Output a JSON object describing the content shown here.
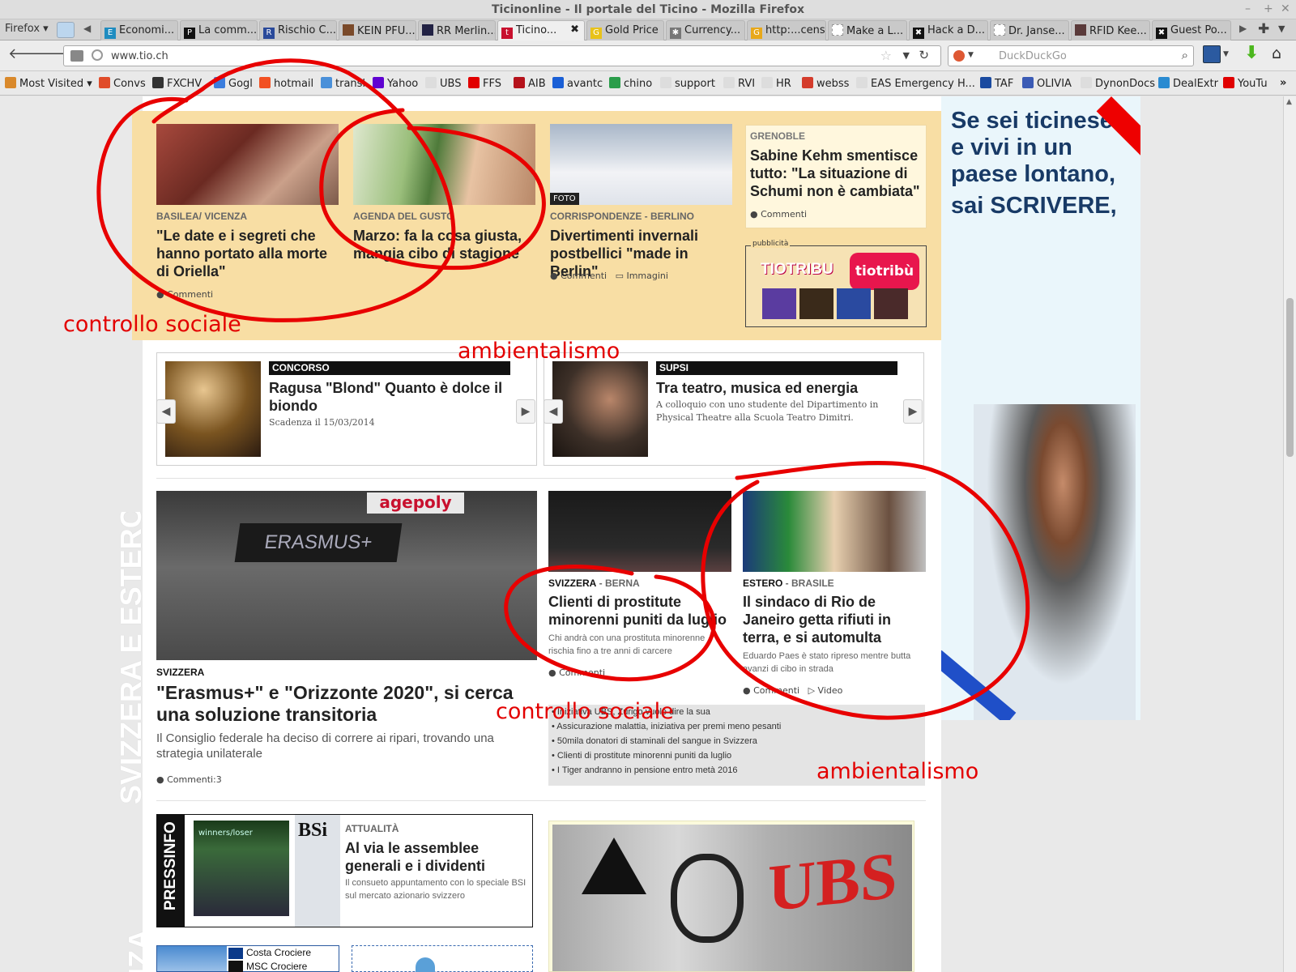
{
  "window": {
    "title": "Ticinonline - Il portale del Ticino - Mozilla Firefox",
    "controls": [
      "–",
      "+",
      "✕"
    ]
  },
  "tabs": {
    "menu": "Firefox ▾",
    "items": [
      {
        "label": "Economi...",
        "icon": "EFJ"
      },
      {
        "label": "La comm...",
        "icon": "Ph"
      },
      {
        "label": "Rischio C...",
        "icon": "Rc"
      },
      {
        "label": "KEIN PFU...",
        "icon": ""
      },
      {
        "label": "RR Merlin...",
        "icon": ""
      },
      {
        "label": "Ticino...",
        "icon": "tio"
      },
      {
        "label": "Gold Price",
        "icon": "G"
      },
      {
        "label": "Currency...",
        "icon": ""
      },
      {
        "label": "http:...cens",
        "icon": "G"
      },
      {
        "label": "Make a L...",
        "icon": ""
      },
      {
        "label": "Hack a D...",
        "icon": ""
      },
      {
        "label": "Dr. Janse...",
        "icon": ""
      },
      {
        "label": "RFID Kee...",
        "icon": ""
      },
      {
        "label": "Guest Po...",
        "icon": ""
      }
    ],
    "close": "✖"
  },
  "navbar": {
    "url": "www.tio.ch",
    "search_placeholder": "DuckDuckGo"
  },
  "bookmarks": [
    {
      "label": "Most Visited ▾",
      "color": "#d9892b"
    },
    {
      "label": "Convs",
      "color": "#e04c2a"
    },
    {
      "label": "FXCHV",
      "color": "#333333"
    },
    {
      "label": "Gogl",
      "color": "#3b7ddd"
    },
    {
      "label": "hotmail",
      "color": "#f25022"
    },
    {
      "label": "transl",
      "color": "#4a90d9"
    },
    {
      "label": "Yahoo",
      "color": "#5f01d1"
    },
    {
      "label": "UBS",
      "color": "#dddddd"
    },
    {
      "label": "FFS",
      "color": "#e10000"
    },
    {
      "label": "AIB",
      "color": "#b5121b"
    },
    {
      "label": "avantc",
      "color": "#1a5fd6"
    },
    {
      "label": "chino",
      "color": "#2a9d4a"
    },
    {
      "label": "support",
      "color": "#dddddd"
    },
    {
      "label": "RVI",
      "color": "#dddddd"
    },
    {
      "label": "HR",
      "color": "#dddddd"
    },
    {
      "label": "webss",
      "color": "#d43c2c"
    },
    {
      "label": "EAS Emergency H...",
      "color": "#dddddd"
    },
    {
      "label": "TAF",
      "color": "#1b4ba0"
    },
    {
      "label": "OLIVIA",
      "color": "#3b5bb5"
    },
    {
      "label": "DynonDocs",
      "color": "#dddddd"
    },
    {
      "label": "DealExtr",
      "color": "#2a8bd1"
    },
    {
      "label": "YouTu",
      "color": "#e00000"
    }
  ],
  "bookmarks_more": "»",
  "hero": [
    {
      "kicker": "BASILEA/ VICENZA",
      "title": "\"Le date e i segreti che hanno portato alla morte di Oriella\"",
      "meta": "Commenti"
    },
    {
      "kicker": "AGENDA DEL GUSTO",
      "title": "Marzo: fa la cosa giusta, mangia cibo di stagione",
      "meta": ""
    },
    {
      "kicker": "CORRISPONDENZE - BERLINO",
      "title": "Divertimenti invernali postbellici \"made in Berlin\"",
      "meta": "Commenti",
      "meta2": "Immagini",
      "badge": "FOTO"
    }
  ],
  "grenoble": {
    "kicker": "GRENOBLE",
    "title": "Sabine Kehm smentisce tutto: \"La situazione di Schumi non è cambiata\"",
    "meta": "Commenti"
  },
  "ad_small": {
    "label": "pubblicità",
    "brand": "TIOTRIBU",
    "logo": "tiotribù"
  },
  "cards": [
    {
      "category": "CONCORSO",
      "title": "Ragusa \"Blond\" Quanto è dolce il biondo",
      "text": "Scadenza il 15/03/2014"
    },
    {
      "category": "SUPSI",
      "title": "Tra teatro, musica ed energia",
      "text": "A colloquio con uno studente del Dipartimento in Physical Theatre alla Scuola Teatro Dimitri."
    }
  ],
  "section_title": "SVIZZERA E ESTERO",
  "main_story": {
    "kicker": "SVIZZERA",
    "title": "\"Erasmus+\" e \"Orizzonte 2020\", si cerca una soluzione transitoria",
    "lead": "Il Consiglio federale ha deciso di correre ai ripari, trovando una strategia unilaterale",
    "meta": "Commenti:3",
    "photo_text": "ERASMUS+",
    "banner": "agepoly"
  },
  "story_berna": {
    "kicker": "SVIZZERA",
    "sub": " - BERNA",
    "title": "Clienti di prostitute minorenni puniti da luglio",
    "lead": "Chi andrà con una prostituta minorenne rischia fino a tre anni di carcere",
    "meta": "Commenti"
  },
  "story_brasile": {
    "kicker": "ESTERO",
    "sub": " - BRASILE",
    "title": "Il sindaco di Rio de Janeiro getta rifiuti in terra, e si automulta",
    "lead": "Eduardo Paes è stato ripreso mentre butta avanzi di cibo in strada",
    "meta": "Commenti",
    "meta2": "Video"
  },
  "bullets": [
    "• Iniziativa UBS, Zurigo vuole dire la sua",
    "• Assicurazione malattia, iniziativa per premi meno pesanti",
    "• 50mila donatori di staminali del sangue in Svizzera",
    "• Clienti di prostitute minorenni puniti da luglio",
    "• I Tiger andranno in pensione entro metà 2016"
  ],
  "right_ad": {
    "line1": "Se sei ticinese",
    "line2": "e vivi in un",
    "line3": "paese lontano,",
    "line4": "sai SCRIVERE,"
  },
  "pressinfo": {
    "label": "PRESSINFO",
    "logo": "BSi",
    "kicker": "ATTUALITÀ",
    "title": "Al via le assemblee generali e i dividenti",
    "lead": "Il consueto appuntamento con lo speciale BSI sul mercato azionario svizzero",
    "photo_text": "winners/loser"
  },
  "ad_costa": {
    "line1": "Costa Crociere",
    "line2": "MSC Crociere"
  },
  "ubs_ad": {
    "logo": "UBS"
  },
  "bottom_section": "NZA",
  "annotations": {
    "a1": "controllo sociale",
    "a2": "ambientalismo",
    "a3": "controllo sociale",
    "a4": "ambientalismo"
  }
}
